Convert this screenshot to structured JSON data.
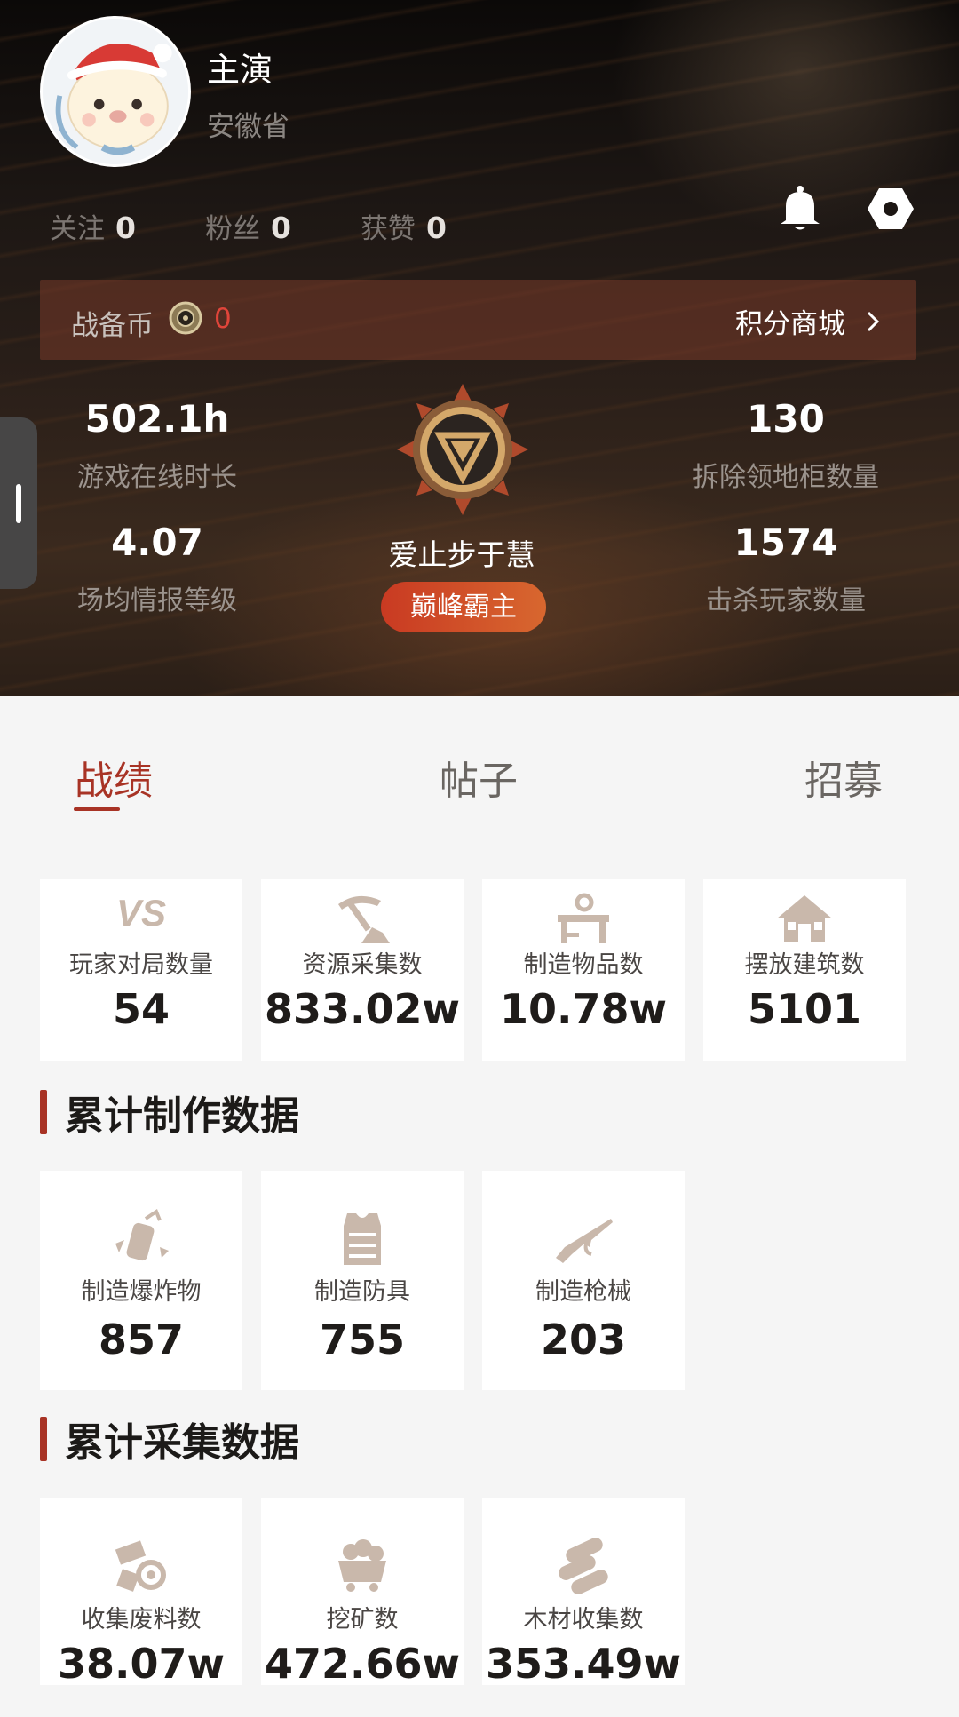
{
  "profile": {
    "username": "主演",
    "province": "安徽省",
    "follow": [
      {
        "label": "关注",
        "count": "0"
      },
      {
        "label": "粉丝",
        "count": "0"
      },
      {
        "label": "获赞",
        "count": "0"
      }
    ],
    "icons": {
      "notifications": "bell-icon",
      "settings": "hexagon-gear-icon"
    }
  },
  "coins": {
    "label": "战备币",
    "value": "0",
    "mall_label": "积分商城"
  },
  "stats": {
    "online_time": {
      "value": "502.1h",
      "label": "游戏在线时长"
    },
    "intel_level": {
      "value": "4.07",
      "label": "场均情报等级"
    },
    "cabinets_removed": {
      "value": "130",
      "label": "拆除领地柜数量"
    },
    "players_killed": {
      "value": "1574",
      "label": "击杀玩家数量"
    }
  },
  "rank": {
    "name": "爱止步于慧",
    "badge": "巅峰霸主"
  },
  "tabs": [
    {
      "label": "战绩",
      "active": true
    },
    {
      "label": "帖子",
      "active": false
    },
    {
      "label": "招募",
      "active": false
    }
  ],
  "overview": [
    {
      "icon": "vs-icon",
      "label": "玩家对局数量",
      "value": "54"
    },
    {
      "icon": "pickaxe-icon",
      "label": "资源采集数",
      "value": "833.02w"
    },
    {
      "icon": "workbench-icon",
      "label": "制造物品数",
      "value": "10.78w"
    },
    {
      "icon": "house-icon",
      "label": "摆放建筑数",
      "value": "5101"
    }
  ],
  "crafting": {
    "title": "累计制作数据",
    "items": [
      {
        "icon": "explosive-icon",
        "label": "制造爆炸物",
        "value": "857"
      },
      {
        "icon": "armor-vest-icon",
        "label": "制造防具",
        "value": "755"
      },
      {
        "icon": "rifle-icon",
        "label": "制造枪械",
        "value": "203"
      }
    ]
  },
  "gathering": {
    "title": "累计采集数据",
    "items": [
      {
        "icon": "scrap-icon",
        "label": "收集废料数",
        "value": "38.07w"
      },
      {
        "icon": "mine-cart-icon",
        "label": "挖矿数",
        "value": "472.66w"
      },
      {
        "icon": "logs-icon",
        "label": "木材收集数",
        "value": "353.49w"
      }
    ]
  },
  "colors": {
    "accent": "#a83325",
    "coin_value": "#e0453a",
    "badge_gradient": [
      "#c93a22",
      "#d8672f"
    ]
  }
}
